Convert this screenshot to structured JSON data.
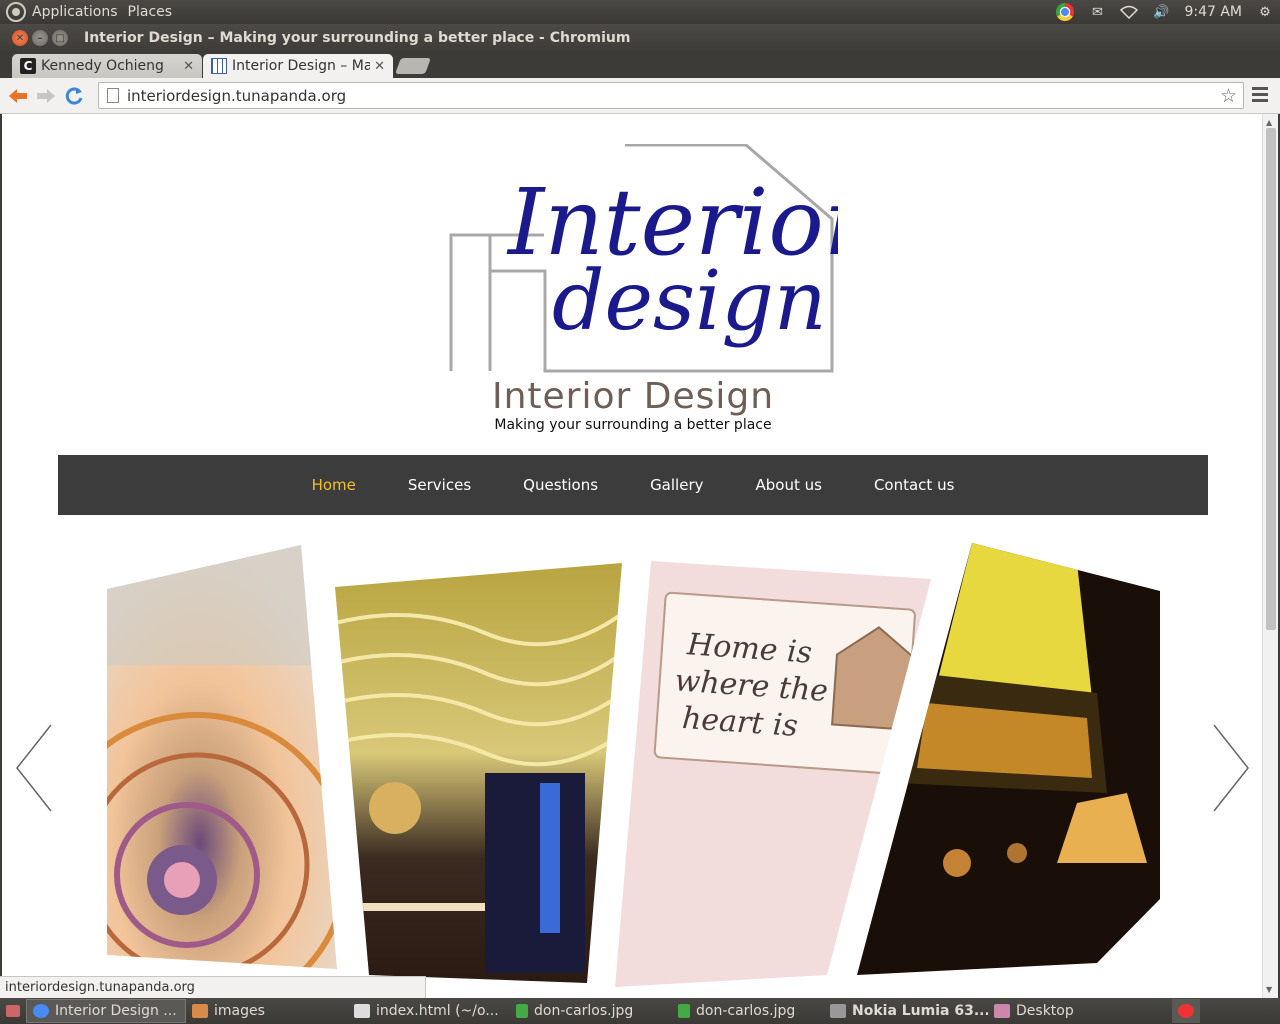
{
  "top_panel": {
    "menus": [
      "Applications",
      "Places"
    ],
    "clock": "9:47 AM"
  },
  "window": {
    "title": "Interior Design – Making your surrounding a better place - Chromium"
  },
  "tabs": [
    {
      "label": "Kennedy Ochieng",
      "favicon": "c-icon"
    },
    {
      "label": "Interior Design – Maki",
      "favicon": "grid-icon"
    }
  ],
  "address_bar": {
    "url": "interiordesign.tunapanda.org"
  },
  "site": {
    "logo_text_line1": "Interior",
    "logo_text_line2": "design",
    "title": "Interior Design",
    "tagline": "Making your surrounding a better place",
    "nav": [
      {
        "label": "Home",
        "active": true
      },
      {
        "label": "Services",
        "active": false
      },
      {
        "label": "Questions",
        "active": false
      },
      {
        "label": "Gallery",
        "active": false
      },
      {
        "label": "About us",
        "active": false
      },
      {
        "label": "Contact us",
        "active": false
      }
    ],
    "slides": [
      {
        "name": "spiral-staircase"
      },
      {
        "name": "wavy-ceiling-hallway"
      },
      {
        "name": "home-sign",
        "sign_lines": [
          "Home is",
          "where the",
          "heart is"
        ]
      },
      {
        "name": "stained-glass-lamp"
      }
    ],
    "colors": {
      "nav_bg": "#3c3c3c",
      "nav_active": "#f0c030",
      "logo_blue": "#1a1a8c",
      "title_color": "#6e5e55"
    }
  },
  "status_bubble": "interiordesign.tunapanda.org",
  "taskbar": [
    {
      "label": "Interior Design ...",
      "current": true,
      "bold": false
    },
    {
      "label": "images",
      "current": false,
      "bold": false
    },
    {
      "label": "index.html (~/o...",
      "current": false,
      "bold": false
    },
    {
      "label": "don-carlos.jpg",
      "current": false,
      "bold": false
    },
    {
      "label": "don-carlos.jpg",
      "current": false,
      "bold": false
    },
    {
      "label": "Nokia Lumia 63...",
      "current": false,
      "bold": true
    },
    {
      "label": "Desktop",
      "current": false,
      "bold": false
    }
  ]
}
